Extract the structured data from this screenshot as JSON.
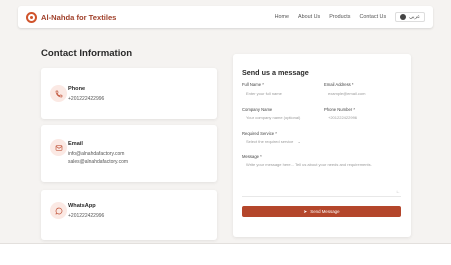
{
  "header": {
    "brand": "Al-Nahda for Textiles",
    "nav": [
      "Home",
      "About Us",
      "Products",
      "Contact Us"
    ],
    "lang": "عربي"
  },
  "contact": {
    "title": "Contact Information",
    "cards": [
      {
        "icon": "phone-icon",
        "title": "Phone",
        "lines": [
          "+201222422996"
        ]
      },
      {
        "icon": "mail-icon",
        "title": "Email",
        "lines": [
          "info@alnahdafactory.com",
          "sales@alnahdafactory.com"
        ]
      },
      {
        "icon": "whatsapp-icon",
        "title": "WhatsApp",
        "lines": [
          "+201222422996"
        ]
      }
    ]
  },
  "form": {
    "title": "Send us a message",
    "full_name_label": "Full Name *",
    "full_name_placeholder": "Enter your full name",
    "email_label": "Email Address *",
    "email_placeholder": "example@email.com",
    "company_label": "Company Name",
    "company_placeholder": "Your company name (optional)",
    "phone_label": "Phone Number *",
    "phone_placeholder": "+201222422996",
    "service_label": "Required Service *",
    "service_value": "Select the required service",
    "message_label": "Message *",
    "message_placeholder": "Write your message here... Tell us about your needs and requirements.",
    "send_label": "Send Message"
  },
  "colors": {
    "accent": "#b4462b",
    "brand": "#a0402a",
    "icon_bg": "#fbe9e4"
  }
}
